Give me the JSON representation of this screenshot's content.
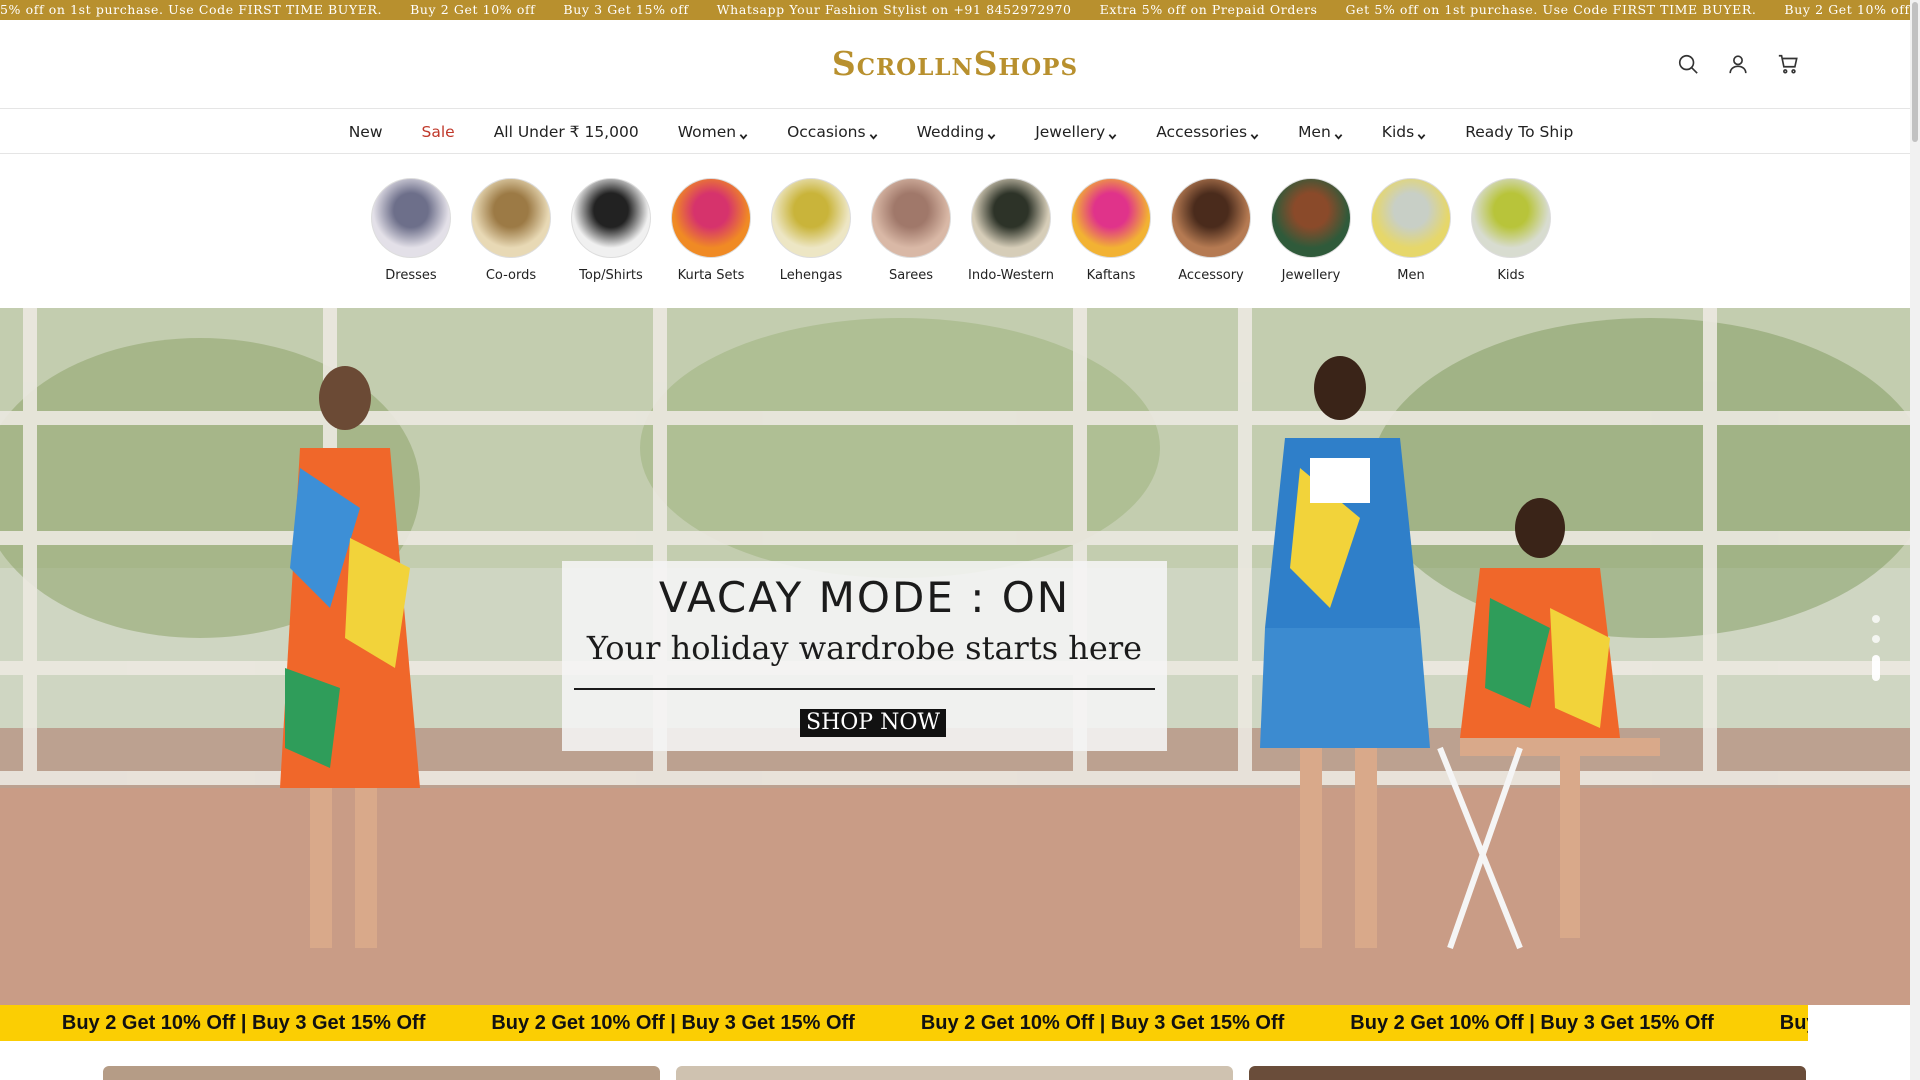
{
  "announcement": {
    "items": [
      "5% off on 1st purchase. Use Code FIRST TIME BUYER.",
      "Buy 2 Get 10% off",
      "Buy 3 Get 15% off",
      "Whatsapp Your Fashion Stylist on +91 8452972970",
      "Extra 5% off on Prepaid Orders",
      "Get 5% off on 1st purchase. Use Code FIRST TIME BUYER.",
      "Buy 2 Get 10% off",
      "Buy 3 Get 15% off"
    ]
  },
  "header": {
    "logo": "ScrollnShops",
    "icons": [
      "search-icon",
      "account-icon",
      "cart-icon"
    ]
  },
  "nav": {
    "items": [
      {
        "label": "New",
        "dropdown": false
      },
      {
        "label": "Sale",
        "dropdown": false
      },
      {
        "label": "All Under ₹ 15,000",
        "dropdown": false
      },
      {
        "label": "Women",
        "dropdown": true
      },
      {
        "label": "Occasions",
        "dropdown": true
      },
      {
        "label": "Wedding",
        "dropdown": true
      },
      {
        "label": "Jewellery",
        "dropdown": true
      },
      {
        "label": "Accessories",
        "dropdown": true
      },
      {
        "label": "Men",
        "dropdown": true
      },
      {
        "label": "Kids",
        "dropdown": true
      },
      {
        "label": "Ready To Ship",
        "dropdown": false
      }
    ],
    "sale_color": "#c0392b"
  },
  "categories": [
    {
      "label": "Dresses",
      "color1": "#6d6f8a",
      "color2": "#e3e0e8"
    },
    {
      "label": "Co-ords",
      "color1": "#9c7a45",
      "color2": "#e8d9b5"
    },
    {
      "label": "Top/Shirts",
      "color1": "#222222",
      "color2": "#f0f0f0"
    },
    {
      "label": "Kurta Sets",
      "color1": "#d6336c",
      "color2": "#f08a24"
    },
    {
      "label": "Lehengas",
      "color1": "#c9b43a",
      "color2": "#ede6c4"
    },
    {
      "label": "Sarees",
      "color1": "#a0786a",
      "color2": "#d9b8a6"
    },
    {
      "label": "Indo-Western",
      "color1": "#2d3328",
      "color2": "#d6cdb8"
    },
    {
      "label": "Kaftans",
      "color1": "#e0338a",
      "color2": "#f2b233"
    },
    {
      "label": "Accessory",
      "color1": "#4a2b1c",
      "color2": "#b57a52"
    },
    {
      "label": "Jewellery",
      "color1": "#8a4a2a",
      "color2": "#2f5a3a"
    },
    {
      "label": "Men",
      "color1": "#c8cfc6",
      "color2": "#e6d76a"
    },
    {
      "label": "Kids",
      "color1": "#b8c43a",
      "color2": "#d8dcd0"
    }
  ],
  "hero": {
    "title": "VACAY MODE : ON",
    "subtitle": "Your holiday wardrobe starts here",
    "cta": "SHOP NOW"
  },
  "offer_marquee": {
    "items": [
      "Off",
      "Buy 2 Get 10% Off | Buy 3 Get 15% Off",
      "Buy 2 Get 10% Off | Buy 3 Get 15% Off",
      "Buy 2 Get 10% Off | Buy 3 Get 15% Off",
      "Buy 2 Get 10% Off | Buy 3 Get 15% Off",
      "Buy 2 Get 10% Off | Buy 3 Get 15% Off",
      "Buy 2 G"
    ],
    "color": "#fbce03"
  },
  "colors": {
    "gold": "#b8902e",
    "card_colors": [
      "#b59c86",
      "#cfc2b0",
      "#6a4d3a"
    ]
  }
}
